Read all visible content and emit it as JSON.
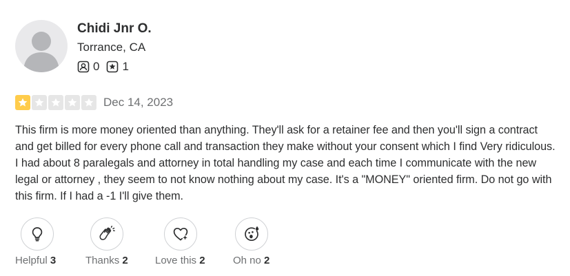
{
  "user": {
    "name": "Chidi Jnr O.",
    "location": "Torrance, CA",
    "friends_count": "0",
    "reviews_count": "1"
  },
  "review": {
    "rating": 1,
    "max_rating": 5,
    "date": "Dec 14, 2023",
    "text": "This firm is more money oriented than anything. They'll ask for a retainer fee and then you'll sign a contract and get billed for every phone call and transaction they make without your consent which I find Very ridiculous. I had about 8 paralegals and attorney in total handling my case and each time I communicate with the new legal or attorney , they seem to not know nothing about my case. It's a \"MONEY\" oriented firm. Do not go with this firm. If I had a -1 I'll give them."
  },
  "reactions": {
    "helpful": {
      "label": "Helpful",
      "count": "3"
    },
    "thanks": {
      "label": "Thanks",
      "count": "2"
    },
    "love": {
      "label": "Love this",
      "count": "2"
    },
    "ohno": {
      "label": "Oh no",
      "count": "2"
    }
  },
  "colors": {
    "star_filled": "#ffcc4b",
    "star_empty": "#e6e6e6",
    "text_primary": "#2d2e2f",
    "text_secondary": "#6e7072"
  },
  "icons": {
    "friends": "friends-icon",
    "reviews": "review-star-icon",
    "helpful": "lightbulb-icon",
    "thanks": "clapping-hands-icon",
    "love": "heart-sparkle-icon",
    "ohno": "shocked-face-icon"
  }
}
